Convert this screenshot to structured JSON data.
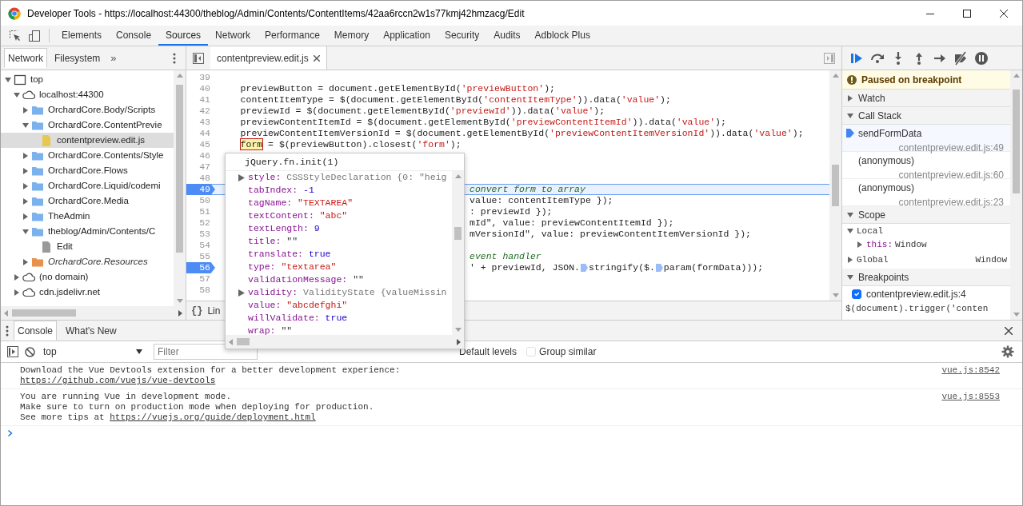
{
  "window": {
    "title": "Developer Tools - https://localhost:44300/theblog/Admin/Contents/ContentItems/42aa6rccn2w1s77kmj42hmzacg/Edit"
  },
  "main_tabs": [
    {
      "label": "Elements",
      "selected": false
    },
    {
      "label": "Console",
      "selected": false
    },
    {
      "label": "Sources",
      "selected": true
    },
    {
      "label": "Network",
      "selected": false
    },
    {
      "label": "Performance",
      "selected": false
    },
    {
      "label": "Memory",
      "selected": false
    },
    {
      "label": "Application",
      "selected": false
    },
    {
      "label": "Security",
      "selected": false
    },
    {
      "label": "Audits",
      "selected": false
    },
    {
      "label": "Adblock Plus",
      "selected": false
    }
  ],
  "navigator": {
    "tabs": [
      {
        "label": "Network",
        "selected": true
      },
      {
        "label": "Filesystem",
        "selected": false
      }
    ],
    "more": "»",
    "tree": [
      {
        "label": "top",
        "kind": "frame",
        "expanded": true,
        "selected": false,
        "children": [
          {
            "label": "localhost:44300",
            "kind": "domain",
            "expanded": true,
            "selected": false,
            "children": [
              {
                "label": "OrchardCore.Body/Scripts",
                "kind": "folder",
                "expanded": false,
                "selected": false
              },
              {
                "label": "OrchardCore.ContentPrevie",
                "kind": "folder",
                "expanded": true,
                "selected": false,
                "children": [
                  {
                    "label": "contentpreview.edit.js",
                    "kind": "script",
                    "selected": true
                  }
                ]
              },
              {
                "label": "OrchardCore.Contents/Style",
                "kind": "folder",
                "expanded": false,
                "selected": false
              },
              {
                "label": "OrchardCore.Flows",
                "kind": "folder",
                "expanded": false,
                "selected": false
              },
              {
                "label": "OrchardCore.Liquid/codemi",
                "kind": "folder",
                "expanded": false,
                "selected": false
              },
              {
                "label": "OrchardCore.Media",
                "kind": "folder",
                "expanded": false,
                "selected": false
              },
              {
                "label": "TheAdmin",
                "kind": "folder",
                "expanded": false,
                "selected": false
              },
              {
                "label": "theblog/Admin/Contents/C",
                "kind": "folder",
                "expanded": true,
                "selected": false,
                "children": [
                  {
                    "label": "Edit",
                    "kind": "document",
                    "selected": false
                  }
                ]
              },
              {
                "label": "OrchardCore.Resources",
                "kind": "resource-folder",
                "expanded": false,
                "selected": false
              }
            ]
          },
          {
            "label": "(no domain)",
            "kind": "domain",
            "expanded": false,
            "selected": false
          },
          {
            "label": "cdn.jsdelivr.net",
            "kind": "domain",
            "expanded": false,
            "selected": false
          }
        ]
      }
    ]
  },
  "editor": {
    "file_tab": "contentpreview.edit.js",
    "format_button": "{}",
    "status": "Lin",
    "lines": [
      {
        "number": "39",
        "breakpoint": false,
        "current": false
      },
      {
        "number": "40",
        "text": "previewButton = document.getElementById('previewButton');",
        "indented": true,
        "breakpoint": false,
        "current": false,
        "covered": false
      },
      {
        "number": "41",
        "text": "contentItemType = $(document.getElementById('contentItemType')).data('value');",
        "indented": true,
        "breakpoint": false,
        "current": false,
        "covered": false
      },
      {
        "number": "42",
        "text": "previewId = $(document.getElementById('previewId')).data('value');",
        "indented": true,
        "breakpoint": false,
        "current": false,
        "covered": false
      },
      {
        "number": "43",
        "text": "previewContentItemId = $(document.getElementById('previewContentItemId')).data('value');",
        "indented": true,
        "breakpoint": false,
        "current": false,
        "covered": false
      },
      {
        "number": "44",
        "text": "previewContentItemVersionId = $(document.getElementById('previewContentItemVersionId')).data('value');",
        "indented": true,
        "breakpoint": false,
        "current": false,
        "covered": false
      },
      {
        "number": "45",
        "hover": "form",
        "text": " = $(previewButton).closest('form');",
        "indented": true,
        "breakpoint": false,
        "current": false,
        "covered": false
      },
      {
        "number": "46",
        "breakpoint": false,
        "current": false
      },
      {
        "number": "47",
        "breakpoint": false,
        "current": false
      },
      {
        "number": "48",
        "breakpoint": false,
        "current": false
      },
      {
        "number": "49",
        "text": "convert form to array",
        "kind": "comment",
        "breakpoint": true,
        "current": true,
        "covered": true
      },
      {
        "number": "50",
        "text": "value: contentItemType });",
        "breakpoint": false,
        "current": false,
        "covered": true
      },
      {
        "number": "51",
        "text": ": previewId });",
        "breakpoint": false,
        "current": false,
        "covered": true
      },
      {
        "number": "52",
        "text": "mId\", value: previewContentItemId });",
        "breakpoint": false,
        "current": false,
        "covered": true
      },
      {
        "number": "53",
        "text": "mVersionId\", value: previewContentItemVersionId });",
        "breakpoint": false,
        "current": false,
        "covered": true
      },
      {
        "number": "54",
        "breakpoint": false,
        "current": false
      },
      {
        "number": "55",
        "text": "event handler",
        "kind": "comment",
        "breakpoint": false,
        "current": false,
        "covered": true
      },
      {
        "number": "56",
        "segments": [
          "' + previewId, JSON.",
          "stringify($.",
          "param(formData)));"
        ],
        "breakpoint": true,
        "current": false,
        "covered": true
      },
      {
        "number": "57",
        "breakpoint": false,
        "current": false
      },
      {
        "number": "58",
        "breakpoint": false,
        "current": false
      }
    ]
  },
  "popover": {
    "title": "jQuery.fn.init(1)",
    "properties": [
      {
        "name": "style:",
        "value": "CSSStyleDeclaration {0: \"heig",
        "kind": "object"
      },
      {
        "name": "tabIndex:",
        "value": "-1",
        "kind": "number"
      },
      {
        "name": "tagName:",
        "value": "\"TEXTAREA\"",
        "kind": "string"
      },
      {
        "name": "textContent:",
        "value": "\"abc\"",
        "kind": "string"
      },
      {
        "name": "textLength:",
        "value": "9",
        "kind": "number"
      },
      {
        "name": "title:",
        "value": "\"\"",
        "kind": "plain"
      },
      {
        "name": "translate:",
        "value": "true",
        "kind": "boolean"
      },
      {
        "name": "type:",
        "value": "\"textarea\"",
        "kind": "string"
      },
      {
        "name": "validationMessage:",
        "value": "\"\"",
        "kind": "plain"
      },
      {
        "name": "validity:",
        "value": "ValidityState {valueMissin",
        "kind": "object"
      },
      {
        "name": "value:",
        "value": "\"abcdefghi\"",
        "kind": "string"
      },
      {
        "name": "willValidate:",
        "value": "true",
        "kind": "boolean"
      },
      {
        "name": "wrap:",
        "value": "\"\"",
        "kind": "plain"
      }
    ]
  },
  "debugger": {
    "banner": "Paused on breakpoint",
    "watch": {
      "title": "Watch",
      "expanded": false
    },
    "call_stack": {
      "title": "Call Stack",
      "expanded": true,
      "frames": [
        {
          "name": "sendFormData",
          "location": "contentpreview.edit.js:49",
          "selected": true
        },
        {
          "name": "(anonymous)",
          "location": "contentpreview.edit.js:60",
          "selected": false
        },
        {
          "name": "(anonymous)",
          "location": "contentpreview.edit.js:23",
          "selected": false
        }
      ]
    },
    "scope": {
      "title": "Scope",
      "expanded": true,
      "groups": [
        {
          "name": "Local",
          "expanded": true,
          "entries": [
            {
              "name": "this:",
              "value": "Window",
              "expanded": false
            }
          ]
        },
        {
          "name": "Global",
          "expanded": false,
          "value": "Window"
        }
      ]
    },
    "breakpoints": {
      "title": "Breakpoints",
      "expanded": true,
      "items": [
        {
          "label": "contentpreview.edit.js:4",
          "checked": true,
          "code": "$(document).trigger('conten"
        }
      ]
    }
  },
  "drawer": {
    "tabs": [
      {
        "label": "Console",
        "selected": true
      },
      {
        "label": "What's New",
        "selected": false
      }
    ],
    "context": "top",
    "filter": {
      "placeholder": "Filter"
    },
    "levels": "Default levels",
    "group_similar": {
      "label": "Group similar",
      "checked": false
    },
    "messages": [
      {
        "lines": [
          {
            "text": "Download the Vue Devtools extension for a better development experience:"
          },
          {
            "link": "https://github.com/vuejs/vue-devtools"
          }
        ],
        "source": "vue.js:8542"
      },
      {
        "lines": [
          {
            "text": "You are running Vue in development mode."
          },
          {
            "text": "Make sure to turn on production mode when deploying for production."
          },
          {
            "text": "See more tips at",
            "link": "https://vuejs.org/guide/deployment.html"
          }
        ],
        "source": "vue.js:8553"
      }
    ]
  }
}
